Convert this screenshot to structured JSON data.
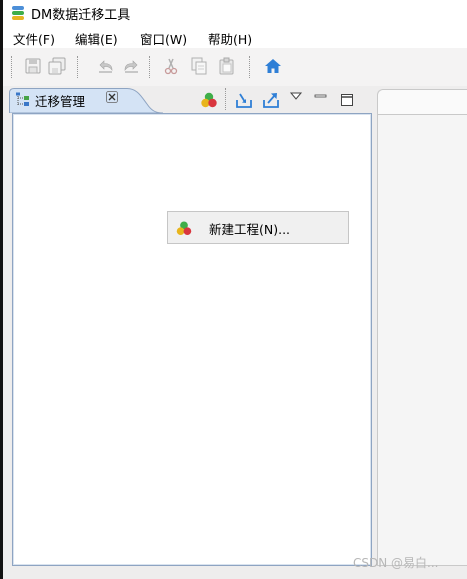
{
  "window": {
    "title": "DM数据迁移工具",
    "app_icon": "database-stack-icon"
  },
  "menubar": {
    "items": [
      {
        "label": "文件(F)"
      },
      {
        "label": "编辑(E)"
      },
      {
        "label": "窗口(W)"
      },
      {
        "label": "帮助(H)"
      }
    ]
  },
  "toolbar": {
    "buttons": [
      {
        "icon": "save-icon",
        "enabled": false
      },
      {
        "icon": "save-all-icon",
        "enabled": false
      },
      {
        "icon": "undo-icon",
        "enabled": false
      },
      {
        "icon": "redo-icon",
        "enabled": false
      },
      {
        "icon": "cut-icon",
        "enabled": false
      },
      {
        "icon": "copy-icon",
        "enabled": false
      },
      {
        "icon": "paste-icon",
        "enabled": false
      },
      {
        "icon": "home-icon",
        "enabled": true
      }
    ]
  },
  "migration_view": {
    "tab_label": "迁移管理",
    "tab_icon": "migration-tree-icon",
    "tools": [
      {
        "icon": "new-project-icon"
      },
      {
        "icon": "import-icon"
      },
      {
        "icon": "export-icon"
      },
      {
        "icon": "view-menu-icon"
      },
      {
        "icon": "minimize-icon"
      },
      {
        "icon": "maximize-icon"
      }
    ],
    "context_menu": {
      "items": [
        {
          "label": "新建工程(N)...",
          "icon": "new-project-icon"
        }
      ]
    }
  },
  "watermark": "CSDN @易白..."
}
